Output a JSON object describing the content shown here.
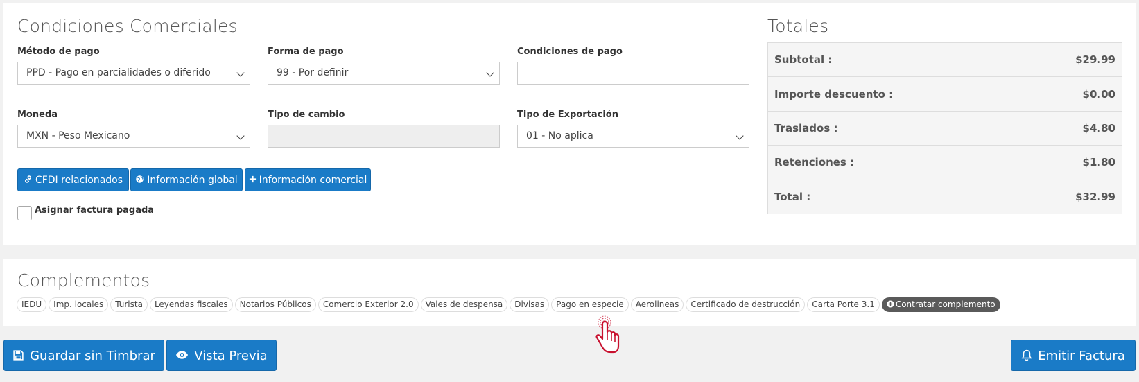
{
  "condiciones": {
    "title": "Condiciones Comerciales",
    "metodo_label": "Método de pago",
    "metodo_value": "PPD - Pago en parcialidades o diferido",
    "forma_label": "Forma de pago",
    "forma_value": "99 - Por definir",
    "condiciones_label": "Condiciones de pago",
    "condiciones_value": "",
    "moneda_label": "Moneda",
    "moneda_value": "MXN - Peso Mexicano",
    "tipo_cambio_label": "Tipo de cambio",
    "tipo_cambio_value": "",
    "exportacion_label": "Tipo de Exportación",
    "exportacion_value": "01 - No aplica",
    "btn_cfdi": "CFDI relacionados",
    "btn_global": "Información global",
    "btn_comercial": "Información comercial",
    "checkbox_label": "Asignar factura pagada"
  },
  "totales": {
    "title": "Totales",
    "rows": [
      {
        "label": "Subtotal :",
        "value": "$29.99"
      },
      {
        "label": "Importe descuento :",
        "value": "$0.00"
      },
      {
        "label": "Traslados :",
        "value": "$4.80"
      },
      {
        "label": "Retenciones :",
        "value": "$1.80"
      },
      {
        "label": "Total :",
        "value": "$32.99"
      }
    ]
  },
  "complementos": {
    "title": "Complementos",
    "chips": [
      "IEDU",
      "Imp. locales",
      "Turista",
      "Leyendas fiscales",
      "Notarios Públicos",
      "Comercio Exterior 2.0",
      "Vales de despensa",
      "Divisas",
      "Pago en especie",
      "Aerolineas",
      "Certificado de destrucción",
      "Carta Porte 3.1"
    ],
    "contratar": "Contratar complemento"
  },
  "footer": {
    "guardar": "Guardar sin Timbrar",
    "vista": "Vista Previa",
    "emitir": "Emitir Factura"
  },
  "colors": {
    "primary": "#1a7bc7",
    "dark_chip": "#5a5a5a",
    "cursor": "#c8102e"
  }
}
